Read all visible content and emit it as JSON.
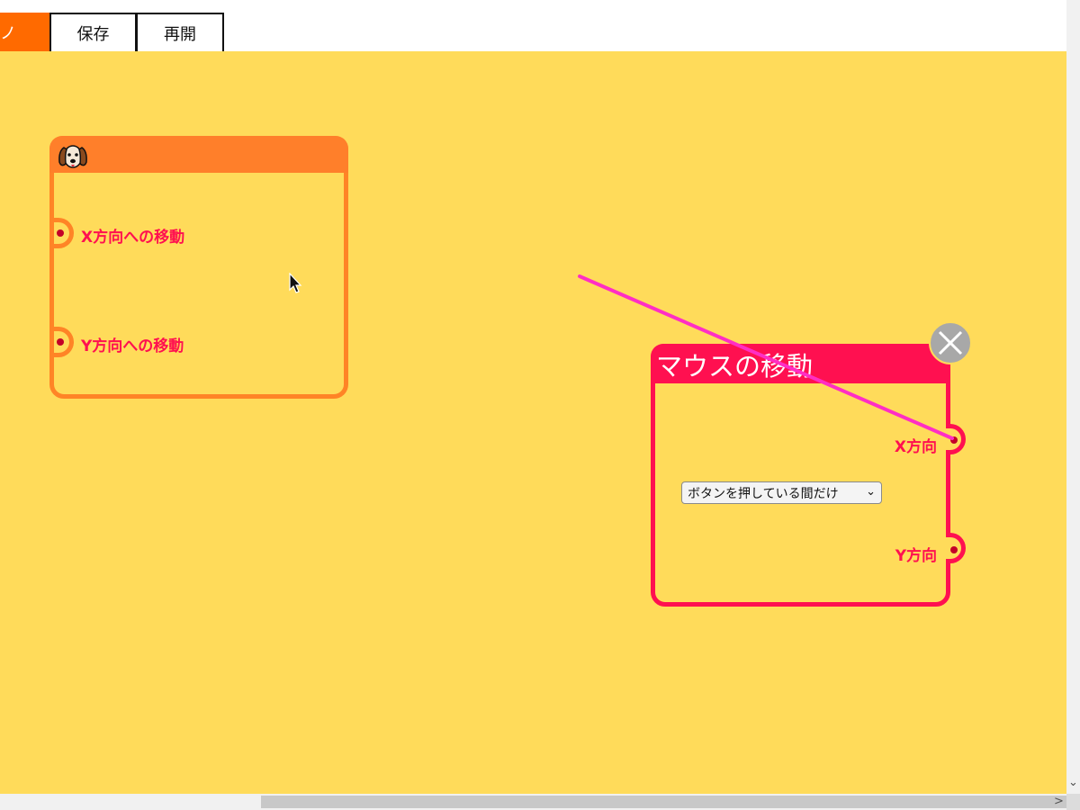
{
  "tabs": [
    {
      "label": "モノ",
      "active": true
    },
    {
      "label": "保存",
      "active": false
    },
    {
      "label": "再開",
      "active": false
    }
  ],
  "sprite_block": {
    "icon": "dog-face-icon",
    "ports": [
      "X方向への移動",
      "Y方向への移動"
    ],
    "color": "#ff7f2a"
  },
  "mouse_block": {
    "title": "マウスの移動",
    "outputs": [
      "X方向",
      "Y方向"
    ],
    "mode_select": {
      "selected": "ボタンを押している間だけ"
    },
    "color": "#ff1050",
    "close_icon": "close-icon"
  },
  "wire": {
    "color": "#ff2ec4"
  },
  "canvas": {
    "background": "#ffdb5a"
  }
}
